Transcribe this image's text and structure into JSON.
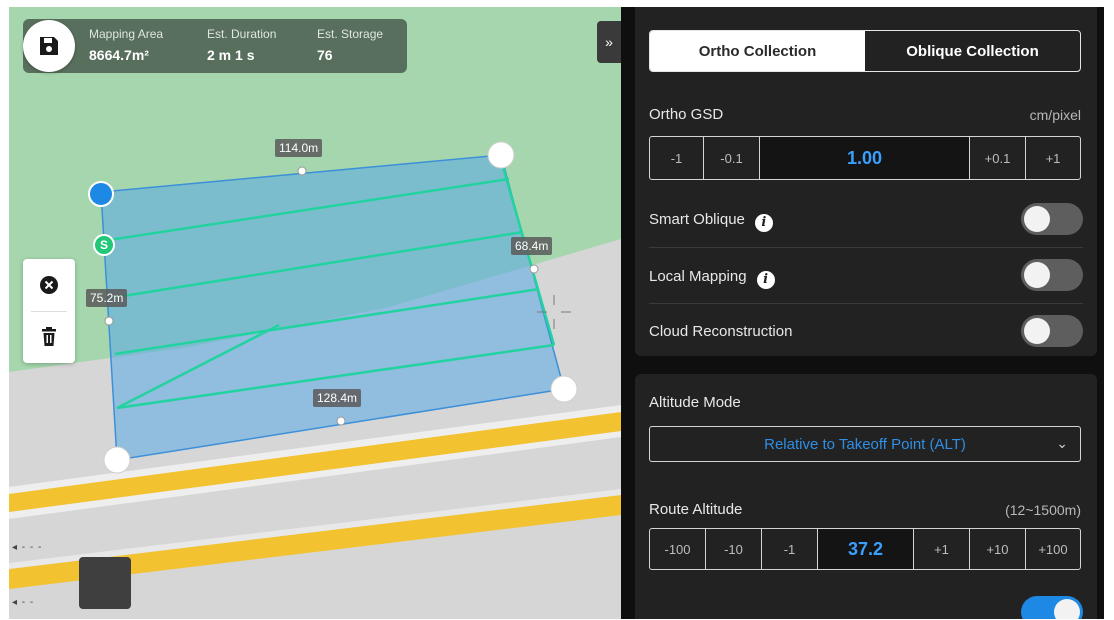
{
  "map": {
    "stats": [
      {
        "label": "Mapping Area",
        "value": "8664.7m²"
      },
      {
        "label": "Est. Duration",
        "value": "2 m 1 s"
      },
      {
        "label": "Est. Storage",
        "value": "76"
      }
    ],
    "expand_glyph": "»",
    "edge_labels": {
      "top": "114.0m",
      "right": "68.4m",
      "left": "75.2m",
      "bottom": "128.4m"
    },
    "start_marker": "S",
    "icons": [
      "save-icon",
      "close-circle-icon",
      "trash-icon"
    ],
    "colors": {
      "polygon": "#5aa9e6",
      "route": "#22d3a0",
      "road": "#f2c230"
    }
  },
  "panel": {
    "tabs": [
      {
        "label": "Ortho Collection",
        "active": true
      },
      {
        "label": "Oblique Collection",
        "active": false
      }
    ],
    "ortho_gsd": {
      "label": "Ortho GSD",
      "unit": "cm/pixel",
      "steps": [
        "-1",
        "-0.1",
        "1.00",
        "+0.1",
        "+1"
      ]
    },
    "toggles": [
      {
        "label": "Smart Oblique",
        "info": "i",
        "on": false
      },
      {
        "label": "Local Mapping",
        "info": "i",
        "on": false
      },
      {
        "label": "Cloud Reconstruction",
        "on": false
      }
    ],
    "altitude_mode": {
      "label": "Altitude Mode",
      "value": "Relative to Takeoff Point (ALT)"
    },
    "route_altitude": {
      "label": "Route Altitude",
      "range": "(12~1500m)",
      "steps": [
        "-100",
        "-10",
        "-1",
        "37.2",
        "+1",
        "+10",
        "+100"
      ]
    },
    "accent": "#1e88e5"
  }
}
